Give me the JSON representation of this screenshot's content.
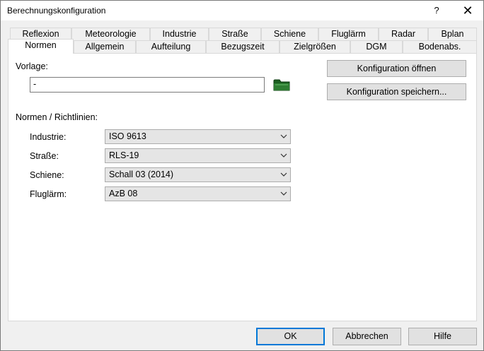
{
  "window": {
    "title": "Berechnungskonfiguration",
    "help_label": "?",
    "close_label": "✕"
  },
  "tabs_row1": [
    {
      "label": "Reflexion"
    },
    {
      "label": "Meteorologie"
    },
    {
      "label": "Industrie"
    },
    {
      "label": "Straße"
    },
    {
      "label": "Schiene"
    },
    {
      "label": "Fluglärm"
    },
    {
      "label": "Radar"
    },
    {
      "label": "Bplan"
    }
  ],
  "tabs_row2": [
    {
      "label": "Normen"
    },
    {
      "label": "Allgemein"
    },
    {
      "label": "Aufteilung"
    },
    {
      "label": "Bezugszeit"
    },
    {
      "label": "Zielgrößen"
    },
    {
      "label": "DGM"
    },
    {
      "label": "Bodenabs."
    }
  ],
  "vorlage": {
    "label": "Vorlage:",
    "value": "-",
    "open_button": "Konfiguration öffnen",
    "save_button": "Konfiguration speichern..."
  },
  "normen": {
    "group_label": "Normen / Richtlinien:",
    "rows": [
      {
        "label": "Industrie:",
        "value": "ISO 9613"
      },
      {
        "label": "Straße:",
        "value": "RLS-19"
      },
      {
        "label": "Schiene:",
        "value": "Schall 03 (2014)"
      },
      {
        "label": "Fluglärm:",
        "value": "AzB 08"
      }
    ]
  },
  "footer": {
    "ok": "OK",
    "cancel": "Abbrechen",
    "help": "Hilfe"
  },
  "colors": {
    "accent": "#0078d7",
    "folder": "#2e7d32"
  }
}
